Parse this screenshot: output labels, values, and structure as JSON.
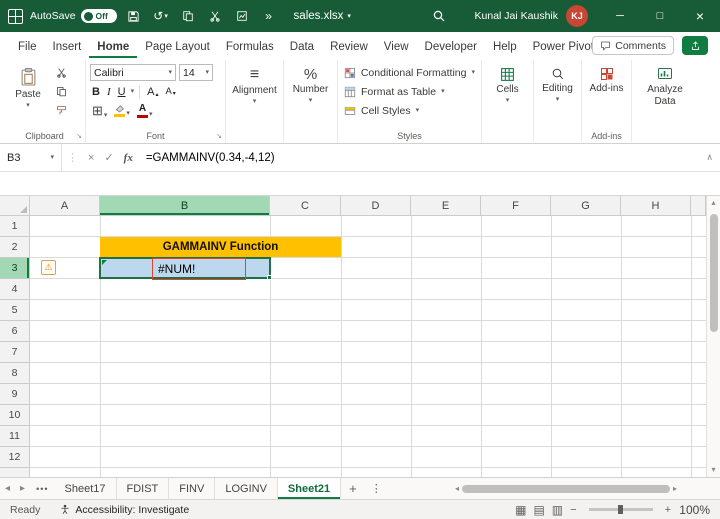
{
  "titlebar": {
    "autosave_label": "AutoSave",
    "autosave_state": "Off",
    "filename": "sales.xlsx",
    "user_name": "Kunal Jai Kaushik",
    "user_initials": "KJ"
  },
  "ribbon_tabs": {
    "items": [
      {
        "label": "File"
      },
      {
        "label": "Insert"
      },
      {
        "label": "Home",
        "active": true
      },
      {
        "label": "Page Layout"
      },
      {
        "label": "Formulas"
      },
      {
        "label": "Data"
      },
      {
        "label": "Review"
      },
      {
        "label": "View"
      },
      {
        "label": "Developer"
      },
      {
        "label": "Help"
      },
      {
        "label": "Power Pivot"
      }
    ],
    "comments_label": "Comments"
  },
  "ribbon": {
    "clipboard": {
      "group_label": "Clipboard",
      "paste_label": "Paste"
    },
    "font": {
      "group_label": "Font",
      "name": "Calibri",
      "size": "14",
      "bold": "B",
      "italic": "I",
      "underline": "U",
      "letter": "A"
    },
    "alignment": {
      "label": "Alignment"
    },
    "number": {
      "label": "Number"
    },
    "styles": {
      "group_label": "Styles",
      "conditional_formatting": "Conditional Formatting",
      "format_as_table": "Format as Table",
      "cell_styles": "Cell Styles"
    },
    "cells": {
      "label": "Cells"
    },
    "editing": {
      "label": "Editing"
    },
    "addins": {
      "label": "Add-ins",
      "group_label": "Add-ins"
    },
    "analyze": {
      "label": "Analyze Data"
    }
  },
  "formula_bar": {
    "cell_ref": "B3",
    "formula": "=GAMMAINV(0.34,-4,12)"
  },
  "grid": {
    "column_headers": [
      "A",
      "B",
      "C",
      "D",
      "E",
      "F",
      "G",
      "H"
    ],
    "row_headers": [
      "1",
      "2",
      "3",
      "4",
      "5",
      "6",
      "7",
      "8",
      "9",
      "10",
      "11",
      "12"
    ],
    "selected_cell": "B3",
    "cells": {
      "b2": {
        "ref": "B2",
        "text": "GAMMAINV Function",
        "bg": "#FFC000"
      },
      "b3": {
        "ref": "B3",
        "text": "#NUM!",
        "bg": "#BDD7EE"
      }
    }
  },
  "sheet_tabs": {
    "items": [
      {
        "label": "Sheet17"
      },
      {
        "label": "FDIST"
      },
      {
        "label": "FINV"
      },
      {
        "label": "LOGINV"
      },
      {
        "label": "Sheet21",
        "active": true
      }
    ]
  },
  "status_bar": {
    "ready": "Ready",
    "accessibility": "Accessibility: Investigate",
    "zoom": "100%"
  },
  "colors": {
    "titlebar_green": "#185C37",
    "excel_green": "#107C41",
    "header_gold": "#FFC000",
    "cell_blue": "#BDD7EE",
    "error_red": "#E0462F",
    "avatar_orange": "#C74634"
  },
  "icons": {
    "chevron_down": "▾",
    "chevron_up": "∧",
    "undo": "↺",
    "more": "»",
    "kebab": "⋮",
    "dots": "•••",
    "nav_left": "◂",
    "nav_right": "▸",
    "scroll_up": "▴",
    "scroll_down": "▾",
    "warning": "⚠",
    "borders": "⊞",
    "align": "≡",
    "percent": "%",
    "plus": "+",
    "minus": "−",
    "close": "×",
    "check": "✓",
    "fx": "fx",
    "launcher": "↘",
    "view_normal": "▦",
    "view_layout": "▤",
    "view_break": "▥",
    "win_min": "─",
    "win_max": "□",
    "win_close": "×"
  }
}
